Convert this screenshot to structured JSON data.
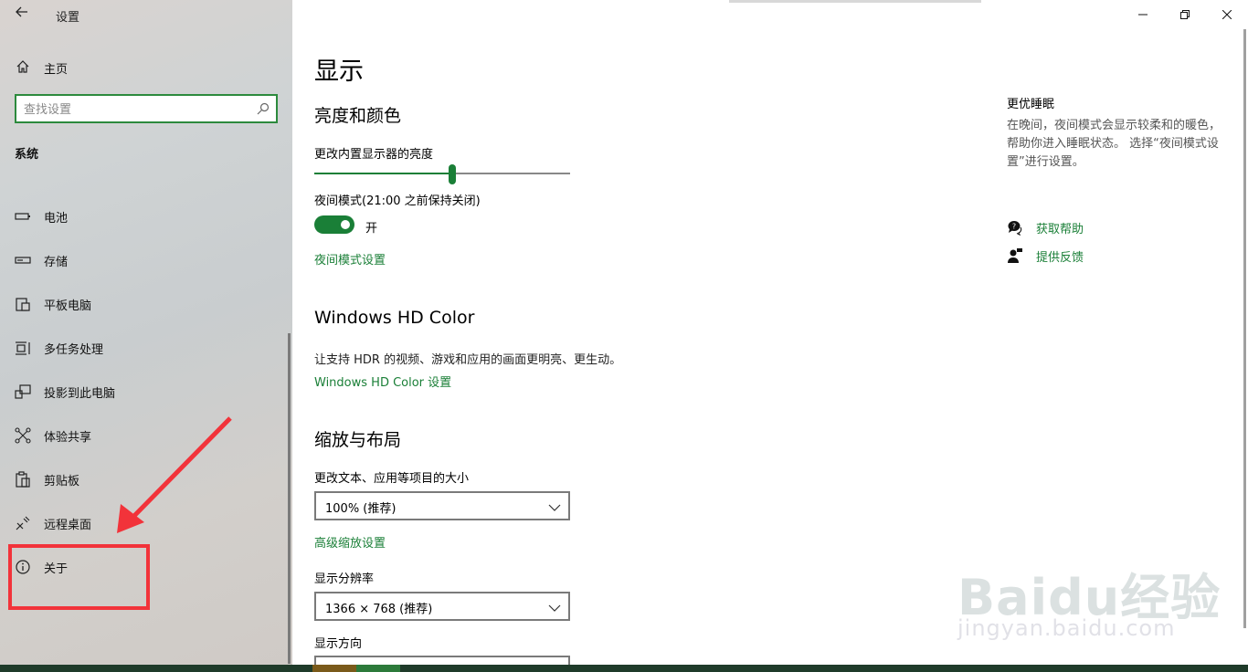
{
  "window": {
    "app_title": "设置",
    "back_icon": "back-arrow-icon",
    "controls": [
      "minimize-icon",
      "restore-icon",
      "close-icon"
    ]
  },
  "sidebar": {
    "home_label": "主页",
    "search_placeholder": "查找设置",
    "group_title": "系统",
    "items": [
      {
        "label": "电池",
        "icon": "battery-icon"
      },
      {
        "label": "存储",
        "icon": "storage-icon"
      },
      {
        "label": "平板电脑",
        "icon": "tablet-icon"
      },
      {
        "label": "多任务处理",
        "icon": "multitasking-icon"
      },
      {
        "label": "投影到此电脑",
        "icon": "project-icon"
      },
      {
        "label": "体验共享",
        "icon": "shared-experience-icon"
      },
      {
        "label": "剪贴板",
        "icon": "clipboard-icon"
      },
      {
        "label": "远程桌面",
        "icon": "remote-desktop-icon"
      },
      {
        "label": "关于",
        "icon": "info-icon"
      }
    ]
  },
  "main": {
    "page_title": "显示",
    "brightness": {
      "section_title": "亮度和颜色",
      "slider_label": "更改内置显示器的亮度",
      "slider_value_pct": 54,
      "night_mode_label": "夜间模式(21:00 之前保持关闭)",
      "night_mode_state": "开",
      "night_mode_on": true,
      "night_mode_link": "夜间模式设置"
    },
    "hdr": {
      "section_title": "Windows HD Color",
      "description": "让支持 HDR 的视频、游戏和应用的画面更明亮、更生动。",
      "link": "Windows HD Color 设置"
    },
    "scale": {
      "section_title": "缩放与布局",
      "size_label": "更改文本、应用等项目的大小",
      "size_value": "100% (推荐)",
      "advanced_link": "高级缩放设置",
      "resolution_label": "显示分辨率",
      "resolution_value": "1366 × 768 (推荐)",
      "orientation_label": "显示方向"
    }
  },
  "aside": {
    "title": "更优睡眠",
    "description": "在晚间，夜间模式会显示较柔和的暖色，帮助你进入睡眠状态。 选择“夜间模式设置”进行设置。",
    "help_label": "获取帮助",
    "feedback_label": "提供反馈"
  },
  "watermark": {
    "text": "Baidu经验",
    "sub": "jingyan.baidu.com"
  },
  "colors": {
    "accent": "#1a7f37",
    "annotation_red": "#f2333a"
  }
}
